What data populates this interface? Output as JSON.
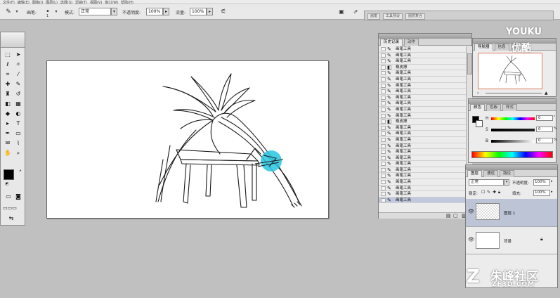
{
  "menubar": {
    "items": [
      "文件(F)",
      "编辑(E)",
      "图像(I)",
      "图层(L)",
      "选择(S)",
      "滤镜(T)",
      "视图(V)",
      "窗口(W)",
      "帮助(H)"
    ]
  },
  "options_bar": {
    "brush_label": "画笔:",
    "brush_size": "1",
    "mode_label": "模式:",
    "mode_value": "正常",
    "opacity_label": "不透明度:",
    "opacity_value": "100%",
    "flow_label": "流量:",
    "flow_value": "100%",
    "palette_well_tabs": [
      "画笔",
      "工具预设",
      "图层复合"
    ]
  },
  "toolbox": {
    "tools": [
      "marquee-icon",
      "move-icon",
      "lasso-icon",
      "magic-wand-icon",
      "crop-icon",
      "slice-icon",
      "healing-icon",
      "brush-icon",
      "stamp-icon",
      "history-brush-icon",
      "eraser-icon",
      "gradient-icon",
      "blur-icon",
      "dodge-icon",
      "path-select-icon",
      "type-icon",
      "pen-icon",
      "shape-icon",
      "notes-icon",
      "eyedropper-icon",
      "hand-icon",
      "zoom-icon"
    ],
    "foreground_color": "#000000",
    "background_color": "#ffffff"
  },
  "history_panel": {
    "tabs": [
      "历史记录",
      "动作"
    ],
    "rows": [
      {
        "icon": "brush-icon",
        "label": "画笔工具"
      },
      {
        "icon": "brush-icon",
        "label": "画笔工具"
      },
      {
        "icon": "brush-icon",
        "label": "画笔工具"
      },
      {
        "icon": "eraser-icon",
        "label": "橡皮擦"
      },
      {
        "icon": "brush-icon",
        "label": "画笔工具"
      },
      {
        "icon": "brush-icon",
        "label": "画笔工具"
      },
      {
        "icon": "brush-icon",
        "label": "画笔工具"
      },
      {
        "icon": "brush-icon",
        "label": "画笔工具"
      },
      {
        "icon": "brush-icon",
        "label": "画笔工具"
      },
      {
        "icon": "brush-icon",
        "label": "画笔工具"
      },
      {
        "icon": "brush-icon",
        "label": "画笔工具"
      },
      {
        "icon": "brush-icon",
        "label": "画笔工具"
      },
      {
        "icon": "eraser-icon",
        "label": "橡皮擦"
      },
      {
        "icon": "brush-icon",
        "label": "画笔工具"
      },
      {
        "icon": "brush-icon",
        "label": "画笔工具"
      },
      {
        "icon": "brush-icon",
        "label": "画笔工具"
      },
      {
        "icon": "brush-icon",
        "label": "画笔工具"
      },
      {
        "icon": "brush-icon",
        "label": "画笔工具"
      },
      {
        "icon": "brush-icon",
        "label": "画笔工具"
      },
      {
        "icon": "brush-icon",
        "label": "画笔工具"
      },
      {
        "icon": "brush-icon",
        "label": "画笔工具"
      },
      {
        "icon": "brush-icon",
        "label": "画笔工具"
      },
      {
        "icon": "brush-icon",
        "label": "画笔工具"
      },
      {
        "icon": "brush-icon",
        "label": "画笔工具"
      },
      {
        "icon": "brush-icon",
        "label": "画笔工具"
      },
      {
        "icon": "brush-icon",
        "label": "画笔工具"
      }
    ]
  },
  "navigator_panel": {
    "tabs": [
      "导航器",
      "信息",
      "直方图"
    ]
  },
  "color_panel": {
    "tabs": [
      "颜色",
      "色板",
      "样式"
    ],
    "sliders": [
      {
        "label": "H",
        "value": "0",
        "unit": "°"
      },
      {
        "label": "S",
        "value": "0",
        "unit": "%"
      },
      {
        "label": "B",
        "value": "0",
        "unit": "%"
      }
    ]
  },
  "layers_panel": {
    "tabs": [
      "图层",
      "通道",
      "路径"
    ],
    "blend_mode": "正常",
    "opacity_label": "不透明度:",
    "opacity_value": "100%",
    "lock_label": "锁定:",
    "fill_label": "填充:",
    "fill_value": "100%",
    "layers": [
      {
        "name": "图层 1",
        "selected": true
      },
      {
        "name": "背景",
        "selected": false
      }
    ]
  },
  "watermarks": {
    "youku": "YOUKU",
    "youku_cn": "优酷",
    "zf_logo": "Z",
    "zf_name": "朱峰社区",
    "zf_url": "ZF3D.COM"
  }
}
